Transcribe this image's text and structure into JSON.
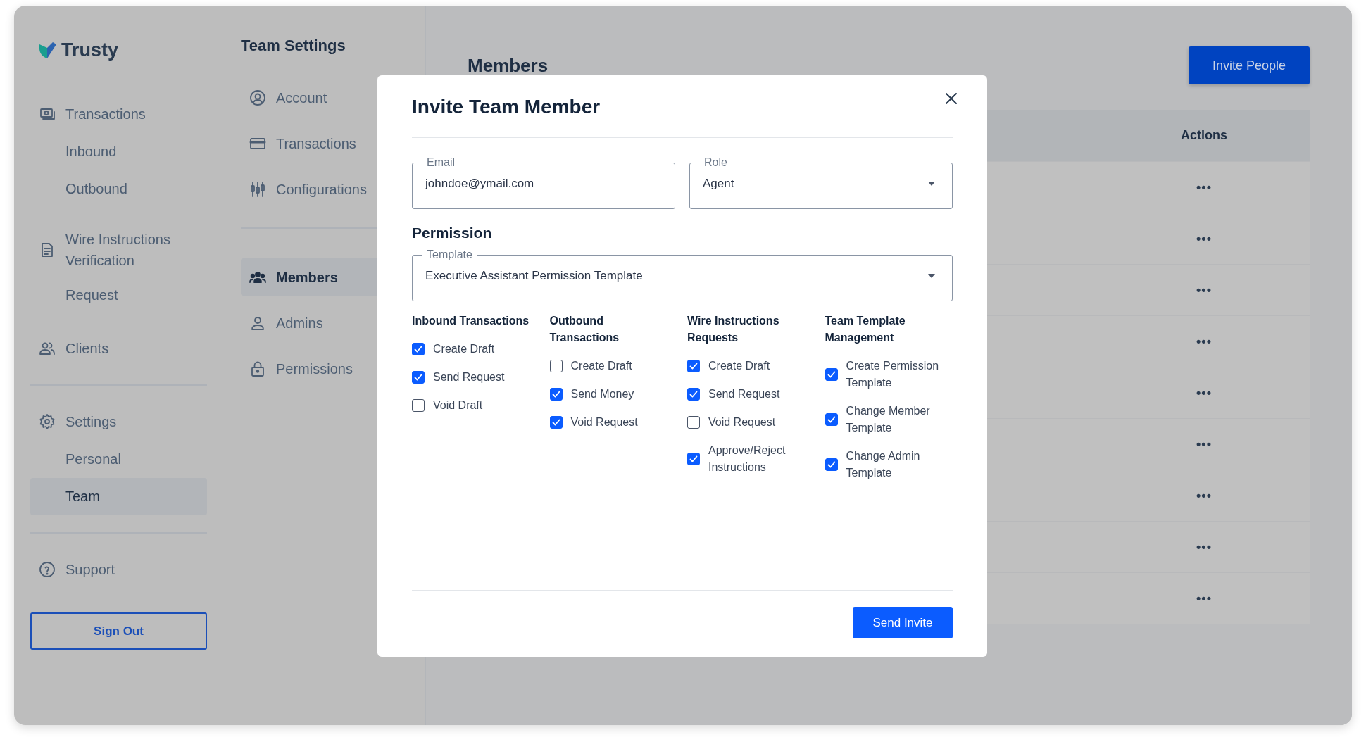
{
  "sidebar": {
    "logo": "Trusty",
    "sections": [
      [
        {
          "label": "Transactions",
          "selected": false,
          "children": [
            {
              "label": "Inbound",
              "selected": false
            },
            {
              "label": "Outbound",
              "selected": false
            }
          ]
        },
        {
          "label": "Wire Instructions Verification",
          "selected": false,
          "children": [
            {
              "label": "Request",
              "selected": false
            }
          ]
        },
        {
          "label": "Clients",
          "selected": false
        }
      ],
      [
        {
          "label": "Settings",
          "selected": false,
          "children": [
            {
              "label": "Personal",
              "selected": false
            },
            {
              "label": "Team",
              "selected": true
            }
          ]
        }
      ],
      [
        {
          "label": "Support",
          "selected": false
        }
      ]
    ],
    "sign_out": "Sign Out"
  },
  "team_settings": {
    "title": "Team Settings",
    "groups": [
      [
        {
          "label": "Account",
          "selected": false
        },
        {
          "label": "Transactions",
          "selected": false
        },
        {
          "label": "Configurations",
          "selected": false
        }
      ],
      [
        {
          "label": "Members",
          "selected": true
        },
        {
          "label": "Admins",
          "selected": false
        },
        {
          "label": "Permissions",
          "selected": false
        }
      ]
    ]
  },
  "main": {
    "title": "Members",
    "invite_button": "Invite People",
    "table": {
      "columns": [
        "Actions"
      ],
      "rows": [
        {
          "actions": "•••"
        },
        {
          "actions": "•••"
        },
        {
          "actions": "•••"
        },
        {
          "actions": "•••"
        },
        {
          "actions": "•••"
        },
        {
          "actions": "•••"
        },
        {
          "actions": "•••"
        },
        {
          "actions": "•••"
        },
        {
          "actions": "•••"
        }
      ]
    }
  },
  "modal": {
    "title": "Invite Team Member",
    "email": {
      "label": "Email",
      "value": "johndoe@ymail.com"
    },
    "role": {
      "label": "Role",
      "value": "Agent"
    },
    "permission_title": "Permission",
    "template": {
      "label": "Template",
      "value": "Executive Assistant Permission Template"
    },
    "groups": [
      {
        "title": "Inbound Transactions",
        "options": [
          {
            "label": "Create Draft",
            "checked": true
          },
          {
            "label": "Send Request",
            "checked": true
          },
          {
            "label": "Void Draft",
            "checked": false
          }
        ]
      },
      {
        "title": "Outbound Transactions",
        "options": [
          {
            "label": "Create Draft",
            "checked": false
          },
          {
            "label": "Send Money",
            "checked": true
          },
          {
            "label": "Void Request",
            "checked": true
          }
        ]
      },
      {
        "title": "Wire Instructions Requests",
        "options": [
          {
            "label": "Create Draft",
            "checked": true
          },
          {
            "label": "Send Request",
            "checked": true
          },
          {
            "label": "Void Request",
            "checked": false
          },
          {
            "label": "Approve/Reject Instructions",
            "checked": true
          }
        ]
      },
      {
        "title": "Team Template Management",
        "options": [
          {
            "label": "Create Permission Template",
            "checked": true
          },
          {
            "label": "Change Member Template",
            "checked": true
          },
          {
            "label": "Change Admin Template",
            "checked": true
          }
        ]
      }
    ],
    "send_button": "Send Invite"
  }
}
